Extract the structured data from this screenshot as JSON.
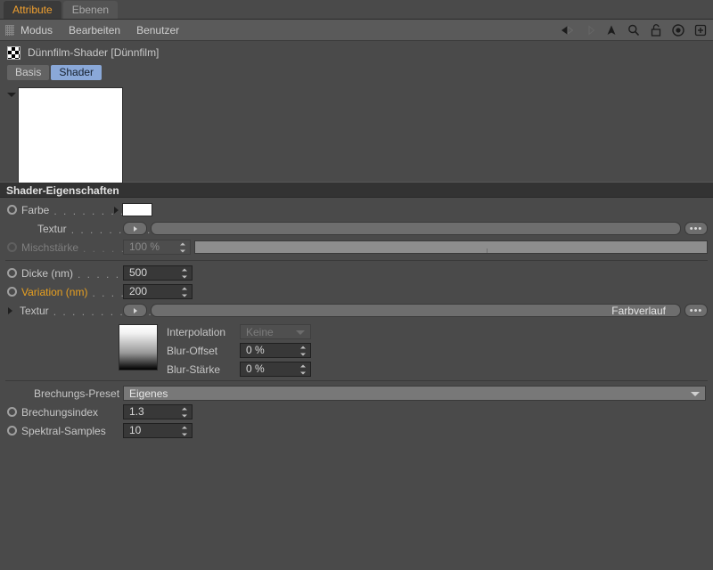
{
  "window": {
    "tabs": [
      {
        "label": "Attribute",
        "active": true
      },
      {
        "label": "Ebenen",
        "active": false
      }
    ],
    "accent_orange": "#f0a030",
    "background": "#4a4a4a",
    "selected_tab_blue": "#8aa8d8"
  },
  "menubar": {
    "grip": "grip-handle",
    "items": [
      "Modus",
      "Bearbeiten",
      "Benutzer"
    ],
    "icons": [
      "back-arrow-icon",
      "forward-arrow-icon",
      "up-arrow-icon",
      "search-icon",
      "lock-icon",
      "target-icon",
      "add-icon"
    ]
  },
  "object": {
    "icon": "checkerboard-shader-icon",
    "title": "Dünnfilm-Shader [Dünnfilm]"
  },
  "subtabs": [
    {
      "label": "Basis",
      "active": false
    },
    {
      "label": "Shader",
      "active": true
    }
  ],
  "preview": {
    "collapse_icon": "triangle-down-icon",
    "color": "#ffffff"
  },
  "section": {
    "title": "Shader-Eigenschaften"
  },
  "params": {
    "farbe": {
      "label": "Farbe",
      "leader": ". . . . . . . . .",
      "swatch": "#ffffff",
      "expand_icon": "triangle-right-icon"
    },
    "textur1": {
      "label": "Textur",
      "leader": ". . . . . . . . . .",
      "value": "",
      "button_icon": "triangle-right-icon",
      "more_label": "•••"
    },
    "mischstaerke": {
      "label": "Mischstärke",
      "leader": ". . . . . .",
      "value": "100 %",
      "slider_percent": 100
    },
    "dicke": {
      "label": "Dicke (nm)",
      "leader": ". . . . . . .",
      "value": "500"
    },
    "variation": {
      "label": "Variation (nm)",
      "leader": ". . . .",
      "value": "200",
      "highlight": true
    },
    "textur2": {
      "label": "Textur",
      "leader": ". . . . . . . . . . .",
      "value": "Farbverlauf",
      "button_icon": "triangle-right-icon",
      "expand_icon": "triangle-right-icon",
      "more_label": "•••"
    },
    "interpolation": {
      "label": "Interpolation",
      "value": "Keine",
      "disabled": true
    },
    "blur_offset": {
      "label": "Blur-Offset",
      "value": "0 %"
    },
    "blur_staerke": {
      "label": "Blur-Stärke",
      "value": "0 %"
    },
    "brechungs_preset": {
      "label": "Brechungs-Preset",
      "value": "Eigenes"
    },
    "brechungsindex": {
      "label": "Brechungsindex",
      "value": "1.3"
    },
    "spektral_samples": {
      "label": "Spektral-Samples",
      "value": "10"
    }
  }
}
